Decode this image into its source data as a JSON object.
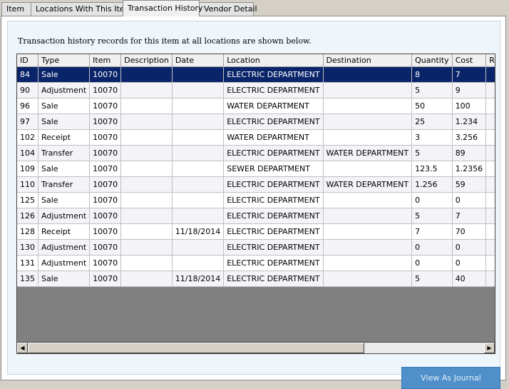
{
  "tabs": [
    "Item",
    "Locations With This Item",
    "Transaction History",
    "Vendor Detail"
  ],
  "caption": "Transaction history records for this item at all locations are shown below.",
  "columns": [
    "ID",
    "Type",
    "Item",
    "Description",
    "Date",
    "Location",
    "Destination",
    "Quantity",
    "Cost",
    "R"
  ],
  "rows": [
    [
      "84",
      "Sale",
      "10070",
      "",
      "",
      "ELECTRIC DEPARTMENT",
      "",
      "8",
      "7",
      ""
    ],
    [
      "90",
      "Adjustment",
      "10070",
      "",
      "",
      "ELECTRIC DEPARTMENT",
      "",
      "5",
      "9",
      ""
    ],
    [
      "96",
      "Sale",
      "10070",
      "",
      "",
      "WATER DEPARTMENT",
      "",
      "50",
      "100",
      ""
    ],
    [
      "97",
      "Sale",
      "10070",
      "",
      "",
      "ELECTRIC DEPARTMENT",
      "",
      "25",
      "1.234",
      ""
    ],
    [
      "102",
      "Receipt",
      "10070",
      "",
      "",
      "WATER DEPARTMENT",
      "",
      "3",
      "3.256",
      ""
    ],
    [
      "104",
      "Transfer",
      "10070",
      "",
      "",
      "ELECTRIC DEPARTMENT",
      "WATER DEPARTMENT",
      "5",
      "89",
      ""
    ],
    [
      "109",
      "Sale",
      "10070",
      "",
      "",
      "SEWER DEPARTMENT",
      "",
      "123.5",
      "1.2356",
      ""
    ],
    [
      "110",
      "Transfer",
      "10070",
      "",
      "",
      "ELECTRIC DEPARTMENT",
      "WATER DEPARTMENT",
      "1.256",
      "59",
      ""
    ],
    [
      "125",
      "Sale",
      "10070",
      "",
      "",
      "ELECTRIC DEPARTMENT",
      "",
      "0",
      "0",
      ""
    ],
    [
      "126",
      "Adjustment",
      "10070",
      "",
      "",
      "ELECTRIC DEPARTMENT",
      "",
      "5",
      "7",
      ""
    ],
    [
      "128",
      "Receipt",
      "10070",
      "",
      "11/18/2014",
      "ELECTRIC DEPARTMENT",
      "",
      "7",
      "70",
      ""
    ],
    [
      "130",
      "Adjustment",
      "10070",
      "",
      "",
      "ELECTRIC DEPARTMENT",
      "",
      "0",
      "0",
      ""
    ],
    [
      "131",
      "Adjustment",
      "10070",
      "",
      "",
      "ELECTRIC DEPARTMENT",
      "",
      "0",
      "0",
      ""
    ],
    [
      "135",
      "Sale",
      "10070",
      "",
      "11/18/2014",
      "ELECTRIC DEPARTMENT",
      "",
      "5",
      "40",
      ""
    ]
  ],
  "view_journal_label": "View As Journal",
  "icons": {
    "scroll_left": "◀",
    "scroll_right": "▶"
  }
}
